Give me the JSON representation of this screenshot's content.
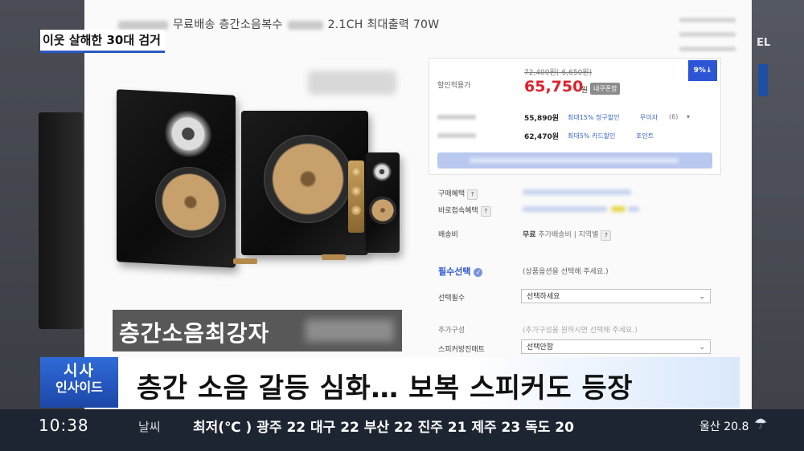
{
  "news": {
    "top_tag": "이웃 살해한 30대 검거",
    "badge_line1": "시사",
    "badge_line2": "인사이드",
    "headline": "층간 소음 갈등 심화… 보복 스피커도 등장",
    "overlay_caption": "층간소음최강자",
    "right_edge_text": "EL"
  },
  "ticker": {
    "time": "10:38",
    "weather_label": "날씨",
    "weather_text": "최저(℃ ) 광주 22 대구 22 부산 22 진주 21 제주 23 독도 20",
    "ulsan": "울산 20.8",
    "weather_icon": "rain-cloud-icon"
  },
  "product": {
    "title_before": "무료배송 층간소음복수",
    "title_after": "2.1CH 최대출력 70W",
    "discount_label": "할인적용가",
    "original_price": "72,400원(-6,650원)",
    "sale_price": "65,750",
    "sale_unit": "원",
    "price_chip": "내쿠폰함",
    "percent_badge": "9%↓",
    "row1_price": "55,890원",
    "row1_link": "최대15% 정구할인",
    "row1_extra": "무이자",
    "row1_count": "(6)",
    "row2_price": "62,470원",
    "row2_link": "최대5% 카드할인",
    "row2_extra": "포인트",
    "benefit_label": "구매혜택",
    "instant_label": "바로접속혜택",
    "shipping_label": "배송비",
    "shipping_value": "무료",
    "shipping_extra": "추가배송비",
    "shipping_region": "지역별",
    "required_title": "필수선택",
    "required_hint": "(상품옵션을 선택해 주세요.)",
    "select_required_label": "선택필수",
    "select_required_value": "선택하세요",
    "extra_label": "추가구성",
    "extra_hint": "(추가구성을 원하시면 선택해 주세요.)",
    "pad_label": "스피커방진매트",
    "pad_value": "선택안함",
    "question_mark": "?"
  },
  "colors": {
    "accent_blue": "#2b59c3",
    "price_red": "#e0202a",
    "ticker_bg": "#1d2532"
  }
}
